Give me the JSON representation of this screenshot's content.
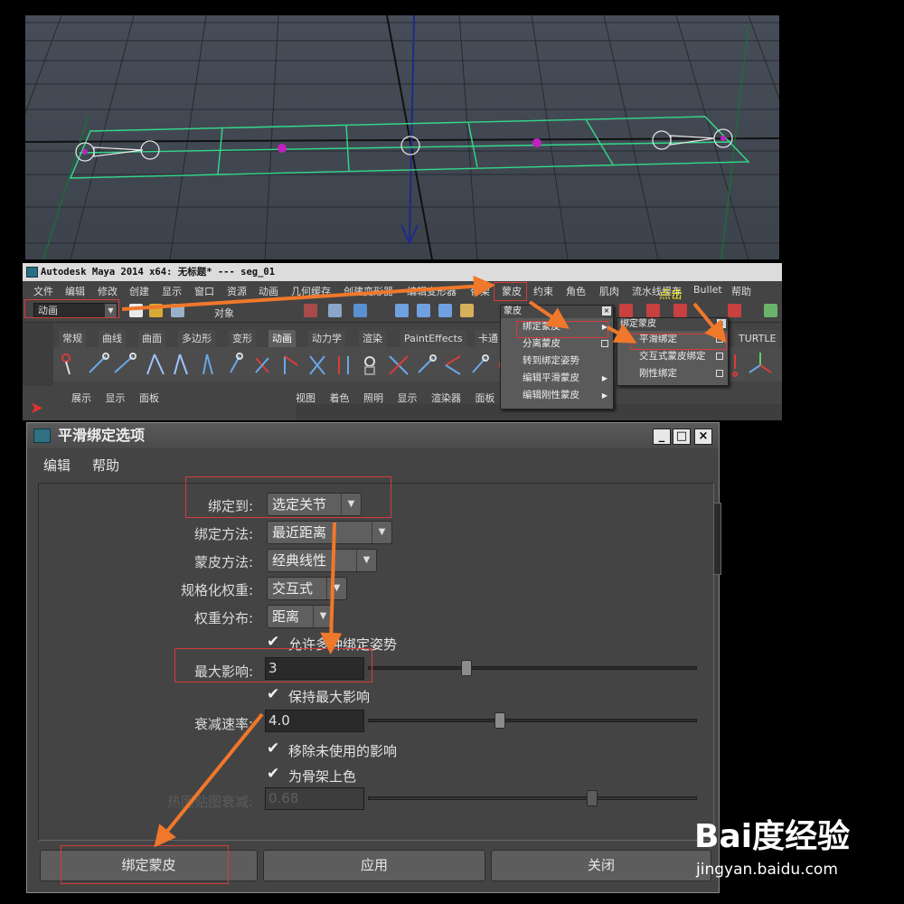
{
  "maya": {
    "title": "Autodesk Maya 2014 x64: 无标题*    ---    seg_01",
    "menu": [
      "文件",
      "编辑",
      "修改",
      "创建",
      "显示",
      "窗口",
      "资源",
      "动画",
      "几何缓存",
      "创建变形器",
      "编辑变形器",
      "骨架",
      "蒙皮",
      "约束",
      "角色",
      "肌肉",
      "流水线缓存",
      "Bullet",
      "帮助"
    ],
    "mode": "动画",
    "object_label": "对象",
    "shelf_tabs": [
      "常规",
      "曲线",
      "曲面",
      "多边形",
      "变形",
      "动画",
      "动力学",
      "渲染",
      "PaintEffects",
      "卡通"
    ],
    "shelf_tab_right": "TURTLE",
    "active_shelf_tab": "动画",
    "panel_menu_left": [
      "展示",
      "显示",
      "面板"
    ],
    "panel_menu_right": [
      "视图",
      "着色",
      "照明",
      "显示",
      "渲染器",
      "面板"
    ],
    "click_annotation": "点击"
  },
  "skin_menu": {
    "title": "蒙皮",
    "items": [
      {
        "label": "绑定蒙皮",
        "kind": "sub"
      },
      {
        "label": "分离蒙皮",
        "kind": "box"
      },
      {
        "label": "转到绑定姿势",
        "kind": "none"
      },
      {
        "label": "编辑平滑蒙皮",
        "kind": "sub"
      },
      {
        "label": "编辑刚性蒙皮",
        "kind": "sub"
      }
    ]
  },
  "bind_menu": {
    "title": "绑定蒙皮",
    "items": [
      {
        "label": "平滑绑定"
      },
      {
        "label": "交互式蒙皮绑定"
      },
      {
        "label": "刚性绑定"
      }
    ]
  },
  "dialog": {
    "title": "平滑绑定选项",
    "menu": [
      "编辑",
      "帮助"
    ],
    "window_buttons": [
      "_",
      "□",
      "×"
    ],
    "bind_to": {
      "label": "绑定到:",
      "value": "选定关节"
    },
    "bind_method": {
      "label": "绑定方法:",
      "value": "最近距离"
    },
    "skin_method": {
      "label": "蒙皮方法:",
      "value": "经典线性"
    },
    "normalize": {
      "label": "规格化权重:",
      "value": "交互式"
    },
    "weight_dist": {
      "label": "权重分布:",
      "value": "距离"
    },
    "allow_multiple": {
      "label": "允许多种绑定姿势",
      "checked": true
    },
    "max_influences": {
      "label": "最大影响:",
      "value": "3",
      "slider": 0.3
    },
    "keep_max": {
      "label": "保持最大影响",
      "checked": true
    },
    "dropoff": {
      "label": "衰减速率:",
      "value": "4.0",
      "slider": 0.4
    },
    "remove_unused": {
      "label": "移除未使用的影响",
      "checked": true
    },
    "color_skeleton": {
      "label": "为骨架上色",
      "checked": true
    },
    "heatmap": {
      "label": "热图贴图衰减:",
      "value": "0.68",
      "slider": 0.68
    },
    "buttons": {
      "bind": "绑定蒙皮",
      "apply": "应用",
      "close": "关闭"
    }
  },
  "watermark": {
    "logo": "Bai度经验",
    "url": "jingyan.baidu.com"
  },
  "colors": {
    "annotation_red": "#d83a3a",
    "arrow_orange": "#f0782a",
    "grid_green": "#33d98a",
    "joint_magenta": "#c020c0"
  }
}
